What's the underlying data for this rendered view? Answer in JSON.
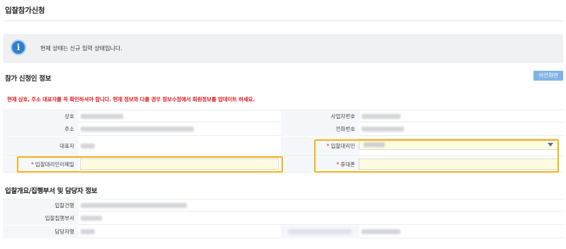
{
  "page": {
    "title": "입찰참가신청"
  },
  "notice": {
    "icon": "info-icon",
    "text": "현재 상태는 신규 입력 상태입니다."
  },
  "applicant_section": {
    "title": "참가 신청인 정보",
    "prev_button": "이전화면",
    "warning": "현재 상호, 주소 대표자를 꼭 확인하셔야 합니다. 현재 정보와 다를 경우 정보수정에서 회원정보를 업데이트 하세요.",
    "labels": {
      "company": "상호",
      "business_no": "사업자번호",
      "address": "주소",
      "phone": "전화번호",
      "ceo": "대표자",
      "agent": "입찰대리인",
      "agent_email": "입찰대리인이메일",
      "mobile": "휴대폰"
    },
    "required_mark": "*",
    "agent_email_value": "",
    "mobile_value": ""
  },
  "bid_section": {
    "title": "입찰개요/집행부서 및 담당자 정보",
    "labels": {
      "bid_name": "입찰건명",
      "dept": "입찰집행부서",
      "manager": "담당자명"
    }
  },
  "colors": {
    "accent": "#2f7fce",
    "highlight": "#f5b417",
    "warning": "#e02020",
    "input_bg": "#fffbe0"
  }
}
